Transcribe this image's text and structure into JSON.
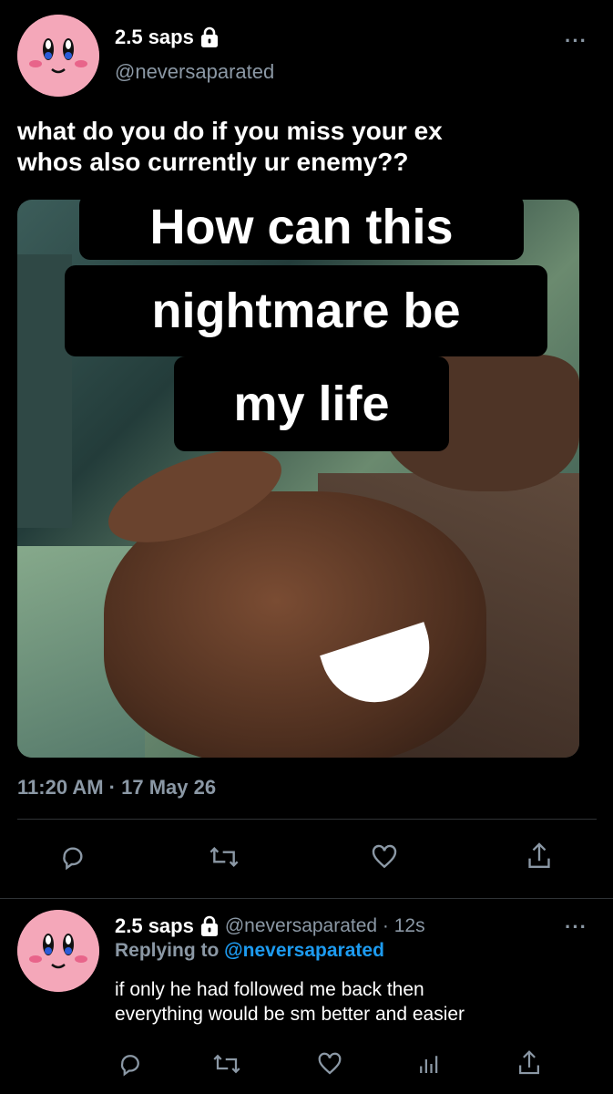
{
  "tweet": {
    "author_name": "2.5 saps",
    "author_handle": "@neversaparated",
    "text_line1": "what do you do if you miss your ex",
    "text_line2": "whos also currently ur enemy??",
    "media_caption_line1": "How can this",
    "media_caption_line2": "nightmare be",
    "media_caption_line3": "my life",
    "timestamp": "11:20 AM · 17 May 26",
    "more_label": "···"
  },
  "reply": {
    "author_name": "2.5 saps",
    "author_handle_time": "@neversaparated · 12s",
    "replying_prefix": "Replying to ",
    "replying_to": "@neversaparated",
    "text_line1": "if only he had followed me back then",
    "text_line2": "everything would be sm better and easier",
    "more_label": "···"
  },
  "colors": {
    "background": "#000000",
    "secondary_text": "#8b98a5",
    "link": "#1d9bf0",
    "avatar_pink": "#f4a7b9"
  },
  "icons": [
    "lock-icon",
    "reply-icon",
    "retweet-icon",
    "like-icon",
    "analytics-icon",
    "share-icon"
  ]
}
